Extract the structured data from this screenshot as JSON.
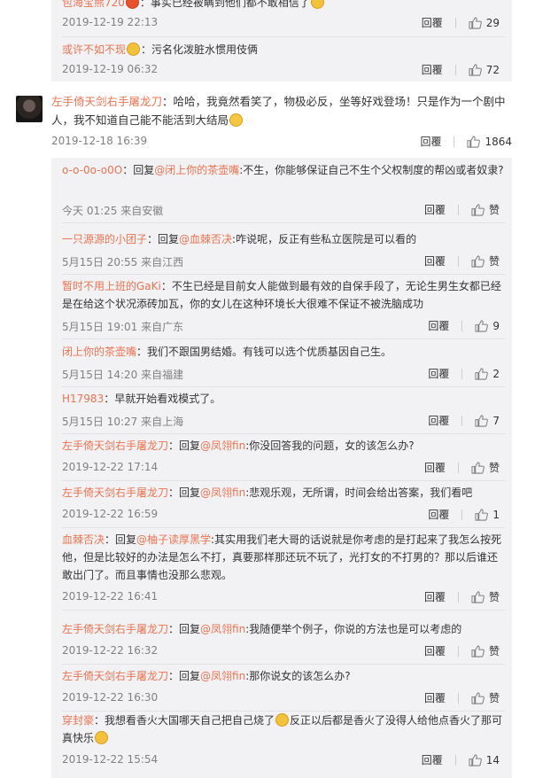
{
  "top_comments": [
    {
      "user": "包海宝熊720",
      "text": "：事实已经被瞒到他们都不敢相信了",
      "time": "2019-12-19 22:13",
      "reply": "回覆",
      "likes": "29"
    },
    {
      "user": "或许不如不现",
      "text": "：污名化泼脏水惯用伎俩",
      "time": "2019-12-19 06:32",
      "reply": "回覆",
      "likes": "72"
    }
  ],
  "main_comment": {
    "user": "左手倚天剑右手屠龙刀",
    "text": "：哈哈，我竟然看笑了，物极必反，坐等好戏登场！只是作为一个剧中人，我不知道自己能不能活到大结局",
    "time": "2019-12-18 16:39",
    "reply": "回覆",
    "likes": "1864"
  },
  "replies": [
    {
      "user": "o-o-0o-o0O",
      "prefix": "：回复",
      "at": "@闭上你的茶壶嘴",
      "text": ":不生，你能够保证自己不生个父权制度的帮凶或者奴隶?",
      "time": "今天 01:25 来自安徽",
      "reply": "回覆",
      "likes": "赞"
    },
    {
      "user": "一只源源的小团子",
      "prefix": "：回复",
      "at": "@血棘否决",
      "text": ":咋说呢，反正有些私立医院是可以看的",
      "time": "5月15日 20:55 来自江西",
      "reply": "回覆",
      "likes": "赞"
    },
    {
      "user": "暂时不用上班的GaKi",
      "prefix": "：",
      "at": "",
      "text": "不生已经是目前女人能做到最有效的自保手段了，无论生男生女都已经是在给这个状况添砖加瓦，你的女儿在这种环境长大很难不保证不被洗脑成功",
      "time": "5月15日 19:01 来自广东",
      "reply": "回覆",
      "likes": "9"
    },
    {
      "user": "闭上你的茶壶嘴",
      "prefix": "：",
      "at": "",
      "text": "我们不跟国男结婚。有钱可以选个优质基因自己生。",
      "time": "5月15日 14:20 来自福建",
      "reply": "回覆",
      "likes": "2"
    },
    {
      "user": "H17983",
      "prefix": "：",
      "at": "",
      "text": "早就开始看戏模式了。",
      "time": "5月15日 10:27 来自上海",
      "reply": "回覆",
      "likes": "7"
    },
    {
      "user": "左手倚天剑右手屠龙刀",
      "prefix": "：回复",
      "at": "@凤翎fin",
      "text": ":你没回答我的问题，女的该怎么办?",
      "time": "2019-12-22 17:14",
      "reply": "回覆",
      "likes": "赞"
    },
    {
      "user": "左手倚天剑右手屠龙刀",
      "prefix": "：回复",
      "at": "@凤翎fin",
      "text": ":悲观乐观，无所谓，时间会给出答案，我们看吧",
      "time": "2019-12-22 16:59",
      "reply": "回覆",
      "likes": "1"
    },
    {
      "user": "血棘否决",
      "prefix": "：回复",
      "at": "@柚子读厚黑学",
      "text": ":其实用我们老大哥的话说就是你考虑的是打起来了我怎么按死他，但是比较好的办法是怎么不打，真要那样那还玩不玩了，光打女的不打男的？那以后谁还敢出门了。而且事情也没那么悲观。",
      "time": "2019-12-22 16:41",
      "reply": "回覆",
      "likes": "赞"
    },
    {
      "user": "左手倚天剑右手屠龙刀",
      "prefix": "：回复",
      "at": "@凤翎fin",
      "text": ":我随便举个例子，你说的方法也是可以考虑的",
      "time": "2019-12-22 16:32",
      "reply": "回覆",
      "likes": "赞"
    },
    {
      "user": "左手倚天剑右手屠龙刀",
      "prefix": "：回复",
      "at": "@凤翎fin",
      "text": ":那你说女的该怎么办?",
      "time": "2019-12-22 16:30",
      "reply": "回覆",
      "likes": "赞"
    },
    {
      "user": "穿封豪",
      "prefix": "：",
      "at": "",
      "text": "我想看香火大国哪天自己把自己烧了",
      "text2": "反正以后都是香火了没得人给他点香火了那可真快乐",
      "time": "2019-12-22 15:54",
      "reply": "回覆",
      "likes": "14"
    }
  ]
}
